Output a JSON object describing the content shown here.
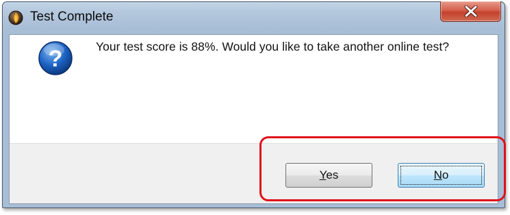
{
  "dialog": {
    "title": "Test Complete",
    "message": "Your test score is 88%.  Would you like to take another online test?",
    "icon": "question-icon",
    "app_icon": "app-icon"
  },
  "buttons": {
    "yes_mnemonic": "Y",
    "yes_rest": "es",
    "no_mnemonic": "N",
    "no_rest": "o",
    "default_button": "No"
  },
  "window_controls": {
    "close_icon": "close-icon"
  },
  "annotation": {
    "highlight_color": "#e0101a",
    "highlight_target": "buttons"
  },
  "colors": {
    "close_button": "#c4412b",
    "default_button_border": "#3c7fb1",
    "question_icon": "#1d64c5"
  }
}
